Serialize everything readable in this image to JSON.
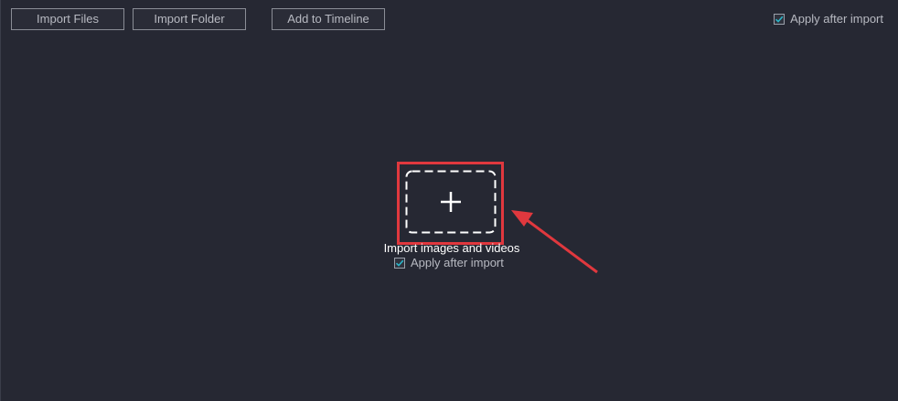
{
  "toolbar": {
    "import_files": "Import Files",
    "import_folder": "Import Folder",
    "add_to_timeline": "Add to Timeline",
    "apply_after_import": "Apply after import",
    "apply_after_import_checked": true
  },
  "drop_zone": {
    "label": "Import images and videos",
    "apply_after_import": "Apply after import",
    "apply_after_import_checked": true,
    "plus_icon": "plus-icon"
  },
  "colors": {
    "background": "#262833",
    "highlight": "#e0383e",
    "check": "#2bb5c8"
  }
}
